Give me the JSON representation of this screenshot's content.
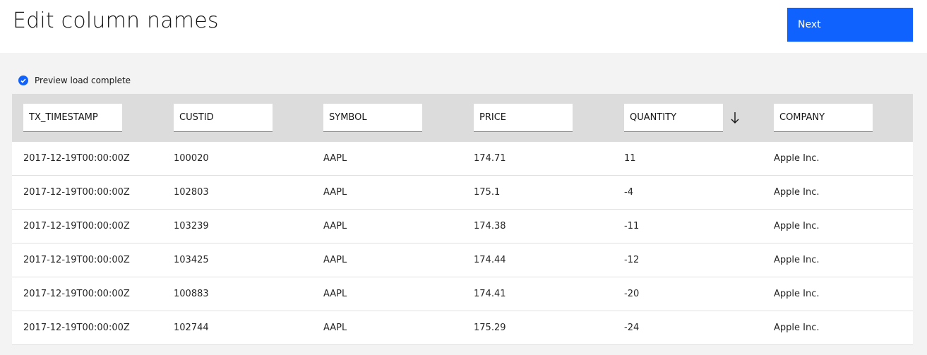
{
  "header": {
    "title": "Edit column names",
    "next_label": "Next"
  },
  "status": {
    "text": "Preview load complete"
  },
  "columns": [
    "TX_TIMESTAMP",
    "CUSTID",
    "SYMBOL",
    "PRICE",
    "QUANTITY",
    "COMPANY"
  ],
  "sort": {
    "column": "QUANTITY",
    "direction": "descending",
    "icon": "arrow-down-icon"
  },
  "rows": [
    [
      "2017-12-19T00:00:00Z",
      "100020",
      "AAPL",
      "174.71",
      "11",
      "Apple Inc."
    ],
    [
      "2017-12-19T00:00:00Z",
      "102803",
      "AAPL",
      "175.1",
      "-4",
      "Apple Inc."
    ],
    [
      "2017-12-19T00:00:00Z",
      "103239",
      "AAPL",
      "174.38",
      "-11",
      "Apple Inc."
    ],
    [
      "2017-12-19T00:00:00Z",
      "103425",
      "AAPL",
      "174.44",
      "-12",
      "Apple Inc."
    ],
    [
      "2017-12-19T00:00:00Z",
      "100883",
      "AAPL",
      "174.41",
      "-20",
      "Apple Inc."
    ],
    [
      "2017-12-19T00:00:00Z",
      "102744",
      "AAPL",
      "175.29",
      "-24",
      "Apple Inc."
    ]
  ],
  "colors": {
    "accent": "#0f62fe",
    "header_bg": "#dcdcdc",
    "page_bg": "#f3f3f3"
  }
}
